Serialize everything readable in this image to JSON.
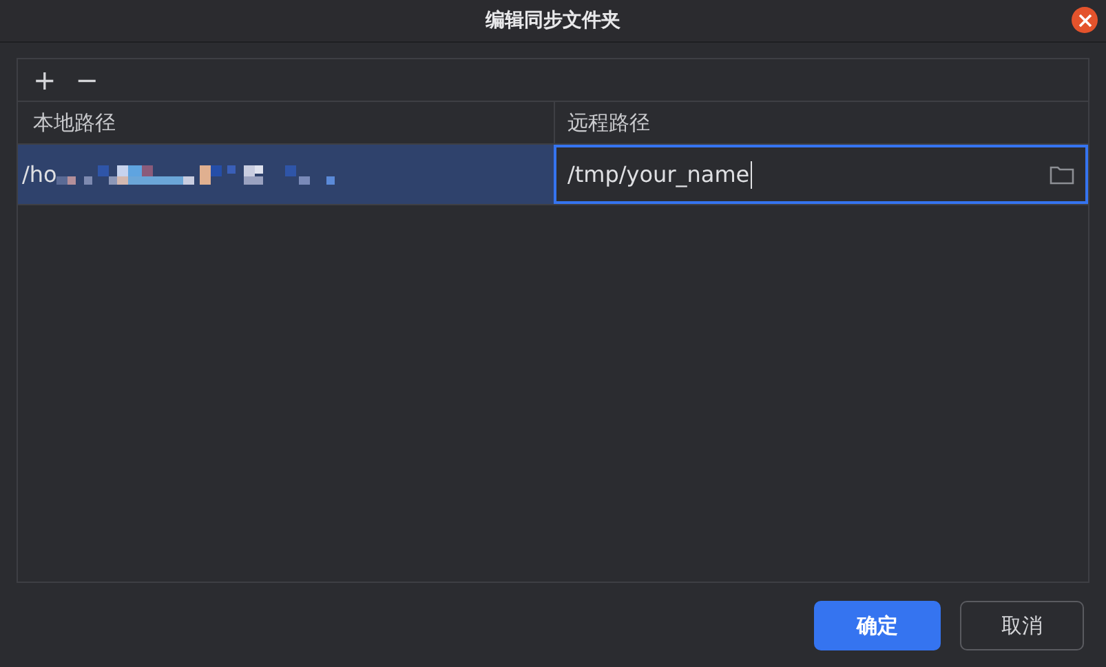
{
  "window": {
    "title": "编辑同步文件夹"
  },
  "toolbar": {
    "add": "+",
    "remove": "−"
  },
  "table": {
    "columns": [
      "本地路径",
      "远程路径"
    ],
    "rows": [
      {
        "local_path": "/ho",
        "remote_path": "/tmp/your_name",
        "selected": true,
        "editing": true
      }
    ]
  },
  "buttons": [
    {
      "label": "确定",
      "kind": "primary"
    },
    {
      "label": "取消",
      "kind": "secondary"
    }
  ]
}
